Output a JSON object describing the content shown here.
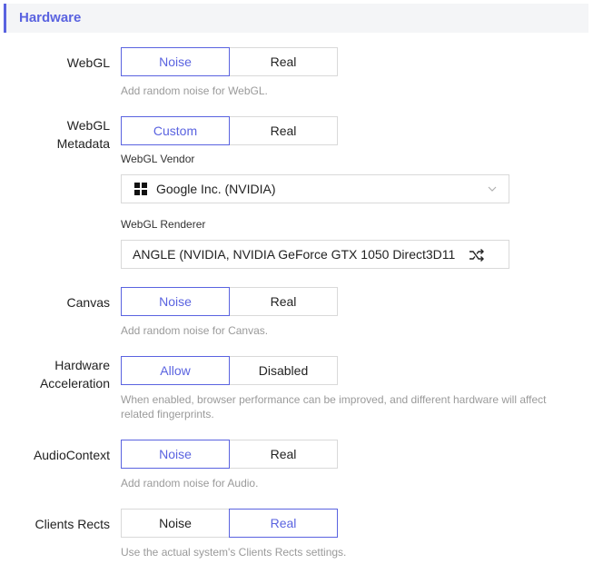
{
  "section": {
    "title": "Hardware"
  },
  "webgl": {
    "label": "WebGL",
    "options": [
      "Noise",
      "Real"
    ],
    "selected": "Noise",
    "hint": "Add random noise for WebGL."
  },
  "webgl_metadata": {
    "label_line1": "WebGL",
    "label_line2": "Metadata",
    "options": [
      "Custom",
      "Real"
    ],
    "selected": "Custom",
    "vendor_label": "WebGL Vendor",
    "vendor_value": "Google Inc. (NVIDIA)",
    "vendor_icon": "windows-icon",
    "renderer_label": "WebGL Renderer",
    "renderer_value": "ANGLE (NVIDIA, NVIDIA GeForce GTX 1050 Direct3D11"
  },
  "canvas": {
    "label": "Canvas",
    "options": [
      "Noise",
      "Real"
    ],
    "selected": "Noise",
    "hint": "Add random noise for Canvas."
  },
  "hardware_acceleration": {
    "label_line1": "Hardware",
    "label_line2": "Acceleration",
    "options": [
      "Allow",
      "Disabled"
    ],
    "selected": "Allow",
    "hint": "When enabled, browser performance can be improved, and different hardware will affect related fingerprints."
  },
  "audio_context": {
    "label": "AudioContext",
    "options": [
      "Noise",
      "Real"
    ],
    "selected": "Noise",
    "hint": "Add random noise for Audio."
  },
  "client_rects": {
    "label": "Clients Rects",
    "options": [
      "Noise",
      "Real"
    ],
    "selected": "Real",
    "hint": "Use the actual system's Clients Rects settings."
  },
  "colors": {
    "accent": "#5a63e0",
    "border": "#d9d9d9",
    "hint": "#9a9a9a"
  }
}
